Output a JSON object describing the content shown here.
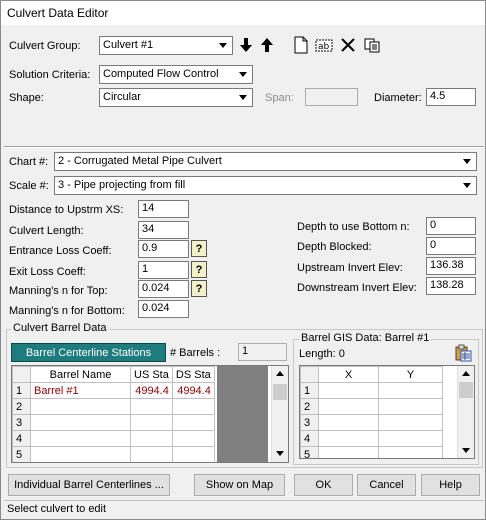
{
  "window": {
    "title": "Culvert Data Editor"
  },
  "group": {
    "label": "Culvert Group:",
    "value": "Culvert #1"
  },
  "solution": {
    "label": "Solution Criteria:",
    "value": "Computed Flow Control"
  },
  "shape": {
    "label": "Shape:",
    "value": "Circular"
  },
  "span": {
    "label": "Span:",
    "value": ""
  },
  "diameter": {
    "label": "Diameter:",
    "value": "4.5"
  },
  "chart": {
    "label": "Chart #:",
    "value": "2 - Corrugated Metal Pipe Culvert"
  },
  "scale": {
    "label": "Scale #:",
    "value": "3 - Pipe projecting from fill"
  },
  "params_left": [
    {
      "label": "Distance to Upstrm XS:",
      "value": "14"
    },
    {
      "label": "Culvert Length:",
      "value": "34"
    },
    {
      "label": "Entrance Loss Coeff:",
      "value": "0.9"
    },
    {
      "label": "Exit Loss Coeff:",
      "value": "1"
    },
    {
      "label": "Manning's n for Top:",
      "value": "0.024"
    },
    {
      "label": "Manning's n for Bottom:",
      "value": "0.024"
    }
  ],
  "params_right": [
    {
      "label": "Depth to use Bottom n:",
      "value": "0"
    },
    {
      "label": "Depth Blocked:",
      "value": "0"
    },
    {
      "label": "Upstream Invert Elev:",
      "value": "136.38"
    },
    {
      "label": "Downstream Invert Elev:",
      "value": "138.28"
    }
  ],
  "help_glyph": "?",
  "barrel": {
    "group_title": "Culvert Barrel Data",
    "stations_button": "Barrel Centerline Stations",
    "count_label": "# Barrels :",
    "count_value": "1",
    "columns": [
      "Barrel Name",
      "US Sta",
      "DS Sta"
    ],
    "rows": [
      {
        "n": "1",
        "name": "Barrel #1",
        "us": "4994.4",
        "ds": "4994.4"
      },
      {
        "n": "2",
        "name": "",
        "us": "",
        "ds": ""
      },
      {
        "n": "3",
        "name": "",
        "us": "",
        "ds": ""
      },
      {
        "n": "4",
        "name": "",
        "us": "",
        "ds": ""
      },
      {
        "n": "5",
        "name": "",
        "us": "",
        "ds": ""
      }
    ]
  },
  "gis": {
    "group_title": "Barrel GIS Data: Barrel #1",
    "length_label": "Length: 0",
    "columns": [
      "X",
      "Y"
    ],
    "rows": [
      "1",
      "2",
      "3",
      "4",
      "5"
    ]
  },
  "buttons": {
    "individual": "Individual Barrel Centerlines ...",
    "map": "Show on Map",
    "ok": "OK",
    "cancel": "Cancel",
    "help": "Help"
  },
  "status": "Select culvert to edit",
  "icons": {
    "toolbar": [
      "down-arrow-icon",
      "up-arrow-icon",
      "new-document-icon",
      "rename-icon",
      "delete-icon",
      "copy-icon"
    ],
    "gis": "paste-table-icon"
  },
  "colors": {
    "accent": "#1e7b7e",
    "value_text": "#8b0000"
  }
}
